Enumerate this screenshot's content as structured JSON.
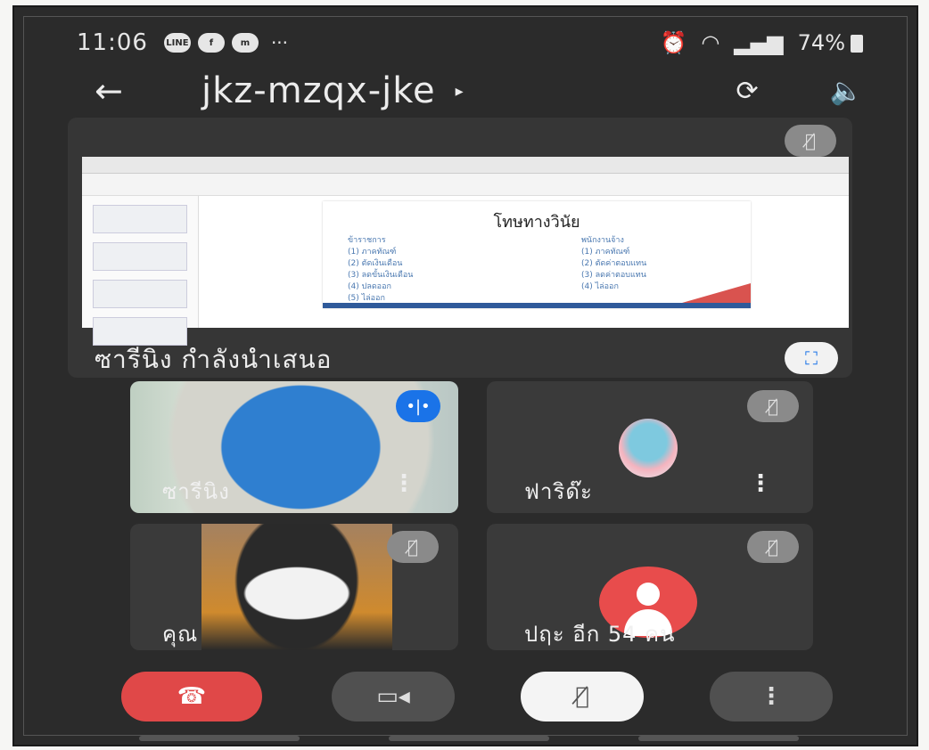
{
  "status_bar": {
    "time": "11:06",
    "app_icons": [
      {
        "icon": "line-icon",
        "label": "LINE"
      },
      {
        "icon": "facebook-icon",
        "label": "f"
      },
      {
        "icon": "messenger-icon",
        "label": "m"
      }
    ],
    "more": "···",
    "battery": "74%"
  },
  "topbar": {
    "meeting_code": "jkz-mzqx-jke",
    "caret": "▸"
  },
  "presentation": {
    "presenter_label": "ซารีนิง กำลังนำเสนอ",
    "slide_title": "โทษทางวินัย",
    "left_column": [
      "ข้าราชการ",
      "(1) ภาคทัณฑ์",
      "(2) ตัดเงินเดือน",
      "(3) ลดขั้นเงินเดือน",
      "(4) ปลดออก",
      "(5) ไล่ออก"
    ],
    "right_column": [
      "พนักงานจ้าง",
      "(1) ภาคทัณฑ์",
      "(2) ตัดค่าตอบแทน",
      "(3) ลดค่าตอบแทน",
      "(4) ไล่ออก"
    ]
  },
  "participants": [
    {
      "name": "ซารีนิง",
      "speaking": true
    },
    {
      "name": "ฟาริด๊ะ",
      "muted": true
    },
    {
      "name": "คุณ",
      "muted": true
    },
    {
      "name": "ปฤะ อีก 54 คน",
      "muted": true
    }
  ],
  "controls": {
    "end_call_icon": "phone-hangup-icon",
    "camera_icon": "camera-icon",
    "mic_icon": "mic-off-icon",
    "more_icon": "more-vert-icon"
  },
  "colors": {
    "background": "#2b2b2b",
    "accent": "#1a73e8",
    "end_call": "#e04848"
  }
}
